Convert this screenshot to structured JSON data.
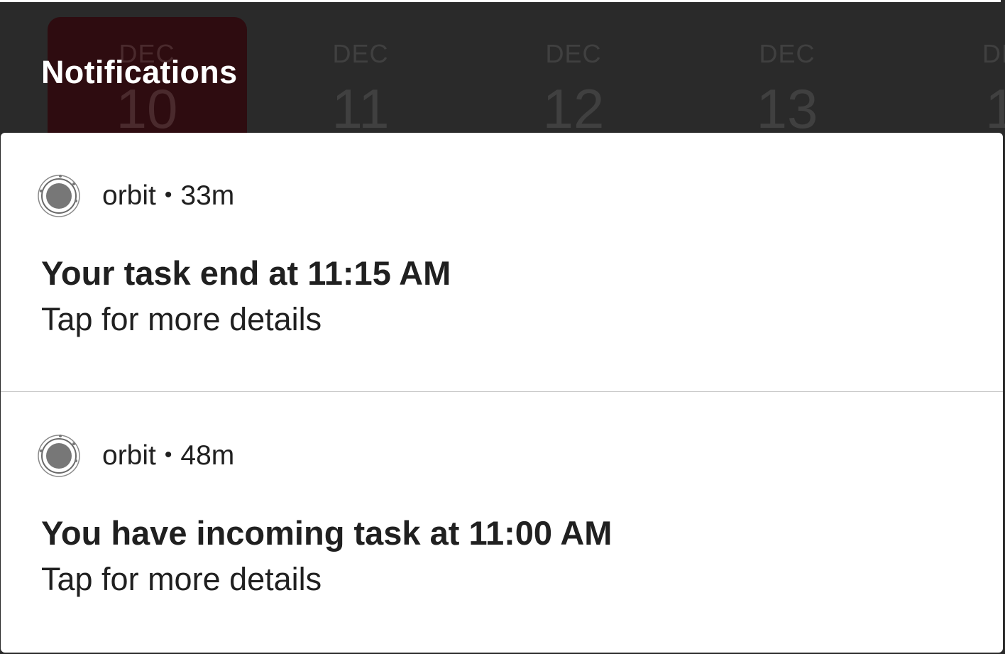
{
  "header": {
    "title": "Notifications"
  },
  "date_strip": {
    "items": [
      {
        "month": "DEC",
        "day": "10",
        "selected": true
      },
      {
        "month": "DEC",
        "day": "11"
      },
      {
        "month": "DEC",
        "day": "12"
      },
      {
        "month": "DEC",
        "day": "13"
      },
      {
        "month": "DE",
        "day": "1"
      }
    ]
  },
  "notifications": [
    {
      "app_name": "orbit",
      "separator": "•",
      "time": "33m",
      "title": "Your task end at 11:15 AM",
      "text": "Tap for more details",
      "icon": "orbit-app-icon"
    },
    {
      "app_name": "orbit",
      "separator": "•",
      "time": "48m",
      "title": "You have incoming task at 11:00 AM",
      "text": "Tap for more details",
      "icon": "orbit-app-icon"
    }
  ]
}
